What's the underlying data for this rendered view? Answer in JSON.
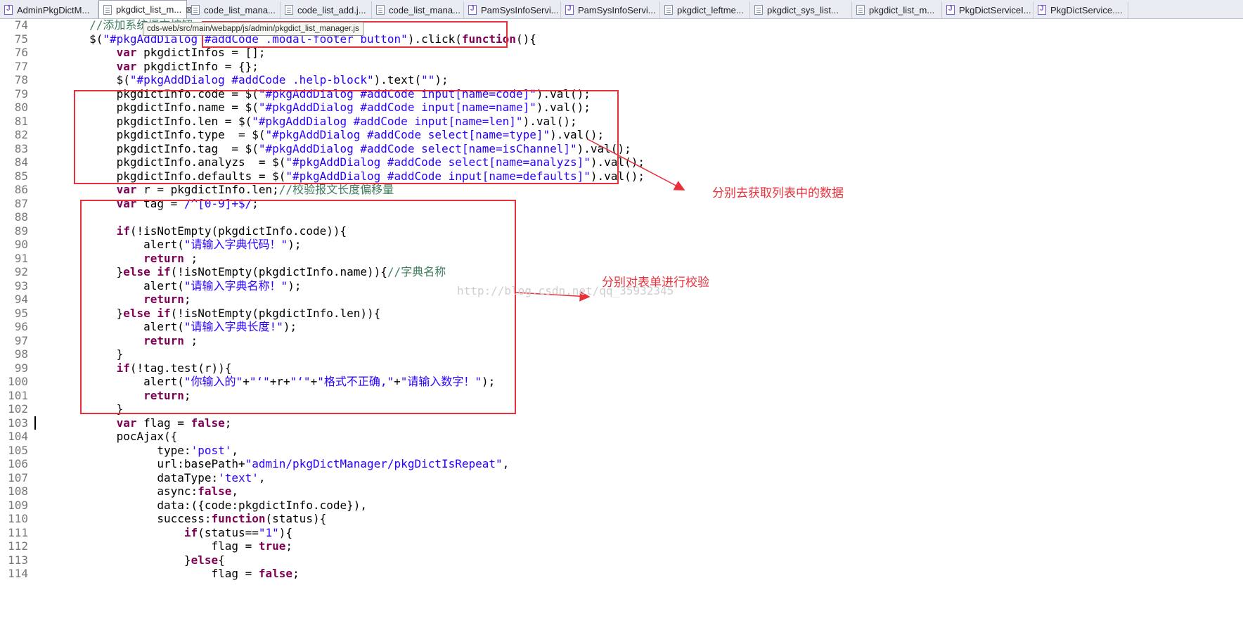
{
  "tabs": [
    {
      "label": "AdminPkgDictM...",
      "icon": "java-file-icon",
      "active": false
    },
    {
      "label": "pkgdict_list_m...",
      "icon": "js-file-icon",
      "active": true
    },
    {
      "label": "code_list_mana...",
      "icon": "js-file-icon",
      "active": false
    },
    {
      "label": "code_list_add.j...",
      "icon": "js-file-icon",
      "active": false
    },
    {
      "label": "code_list_mana...",
      "icon": "js-file-icon",
      "active": false
    },
    {
      "label": "PamSysInfoServi...",
      "icon": "java-file-icon",
      "active": false
    },
    {
      "label": "PamSysInfoServi...",
      "icon": "java-file-icon",
      "active": false
    },
    {
      "label": "pkgdict_leftme...",
      "icon": "js-file-icon",
      "active": false
    },
    {
      "label": "pkgdict_sys_list...",
      "icon": "js-file-icon",
      "active": false
    },
    {
      "label": "pkgdict_list_m...",
      "icon": "js-file-icon",
      "active": false
    },
    {
      "label": "PkgDictServiceI...",
      "icon": "java-file-icon",
      "active": false
    },
    {
      "label": "PkgDictService....",
      "icon": "java-file-icon",
      "active": false
    }
  ],
  "tab_close_glyph": "⊠",
  "tooltip": "cds-web/src/main/webapp/js/admin/pkgdict_list_manager.js",
  "lines": [
    {
      "n": "74",
      "segs": [
        [
          "",
          "        "
        ],
        [
          "cm",
          "//添加系统提交按钮"
        ]
      ]
    },
    {
      "n": "75",
      "segs": [
        [
          "",
          "        $("
        ],
        [
          "str",
          "\"#pkgAddDialog #addCode .modal-footer button\""
        ],
        [
          "",
          ").click("
        ],
        [
          "kw",
          "function"
        ],
        [
          "",
          "(){"
        ]
      ]
    },
    {
      "n": "76",
      "segs": [
        [
          "",
          "            "
        ],
        [
          "kw",
          "var"
        ],
        [
          "",
          " pkgdictInfos = [];"
        ]
      ]
    },
    {
      "n": "77",
      "segs": [
        [
          "",
          "            "
        ],
        [
          "kw",
          "var"
        ],
        [
          "",
          " pkgdictInfo = {};"
        ]
      ]
    },
    {
      "n": "78",
      "segs": [
        [
          "",
          "            $("
        ],
        [
          "str",
          "\"#pkgAddDialog #addCode .help-block\""
        ],
        [
          "",
          ").text("
        ],
        [
          "str",
          "\"\""
        ],
        [
          "",
          ");"
        ]
      ]
    },
    {
      "n": "79",
      "segs": [
        [
          "",
          "            pkgdictInfo.code = $("
        ],
        [
          "str",
          "\"#pkgAddDialog #addCode input[name=code]\""
        ],
        [
          "",
          ").val();"
        ]
      ]
    },
    {
      "n": "80",
      "segs": [
        [
          "",
          "            pkgdictInfo.name = $("
        ],
        [
          "str",
          "\"#pkgAddDialog #addCode input[name=name]\""
        ],
        [
          "",
          ").val();"
        ]
      ]
    },
    {
      "n": "81",
      "segs": [
        [
          "",
          "            pkgdictInfo.len = $("
        ],
        [
          "str",
          "\"#pkgAddDialog #addCode input[name=len]\""
        ],
        [
          "",
          ").val();"
        ]
      ]
    },
    {
      "n": "82",
      "segs": [
        [
          "",
          "            pkgdictInfo.type  = $("
        ],
        [
          "str",
          "\"#pkgAddDialog #addCode select[name=type]\""
        ],
        [
          "",
          ").val();"
        ]
      ]
    },
    {
      "n": "83",
      "segs": [
        [
          "",
          "            pkgdictInfo.tag  = $("
        ],
        [
          "str",
          "\"#pkgAddDialog #addCode select[name=isChannel]\""
        ],
        [
          "",
          ").val();"
        ]
      ]
    },
    {
      "n": "84",
      "segs": [
        [
          "",
          "            pkgdictInfo.analyzs  = $("
        ],
        [
          "str",
          "\"#pkgAddDialog #addCode select[name=analyzs]\""
        ],
        [
          "",
          ").val();"
        ]
      ]
    },
    {
      "n": "85",
      "segs": [
        [
          "",
          "            pkgdictInfo.defaults = $("
        ],
        [
          "str",
          "\"#pkgAddDialog #addCode input[name=defaults]\""
        ],
        [
          "",
          ").val();"
        ]
      ]
    },
    {
      "n": "86",
      "segs": [
        [
          "",
          "            "
        ],
        [
          "kw",
          "var"
        ],
        [
          "",
          " r = pkgdictInfo.len;"
        ],
        [
          "cm",
          "//校验报文长度偏移量"
        ]
      ]
    },
    {
      "n": "87",
      "segs": [
        [
          "",
          "            "
        ],
        [
          "kw",
          "var"
        ],
        [
          "",
          " tag = "
        ],
        [
          "str",
          "/^[0-9]+$/"
        ],
        [
          "",
          ";"
        ]
      ]
    },
    {
      "n": "88",
      "segs": [
        [
          "",
          ""
        ]
      ]
    },
    {
      "n": "89",
      "segs": [
        [
          "",
          "            "
        ],
        [
          "kw",
          "if"
        ],
        [
          "",
          "(!isNotEmpty(pkgdictInfo.code)){"
        ]
      ]
    },
    {
      "n": "90",
      "segs": [
        [
          "",
          "                alert("
        ],
        [
          "str",
          "\"请输入字典代码！\""
        ],
        [
          "",
          ");"
        ]
      ]
    },
    {
      "n": "91",
      "segs": [
        [
          "",
          "                "
        ],
        [
          "kw",
          "return"
        ],
        [
          "",
          " ;"
        ]
      ]
    },
    {
      "n": "92",
      "segs": [
        [
          "",
          "            }"
        ],
        [
          "kw",
          "else if"
        ],
        [
          "",
          "(!isNotEmpty(pkgdictInfo.name)){"
        ],
        [
          "cm",
          "//字典名称"
        ]
      ]
    },
    {
      "n": "93",
      "segs": [
        [
          "",
          "                alert("
        ],
        [
          "str",
          "\"请输入字典名称！\""
        ],
        [
          "",
          ");"
        ]
      ]
    },
    {
      "n": "94",
      "segs": [
        [
          "",
          "                "
        ],
        [
          "kw",
          "return"
        ],
        [
          "",
          ";"
        ]
      ]
    },
    {
      "n": "95",
      "segs": [
        [
          "",
          "            }"
        ],
        [
          "kw",
          "else if"
        ],
        [
          "",
          "(!isNotEmpty(pkgdictInfo.len)){"
        ]
      ]
    },
    {
      "n": "96",
      "segs": [
        [
          "",
          "                alert("
        ],
        [
          "str",
          "\"请输入字典长度!\""
        ],
        [
          "",
          ");"
        ]
      ]
    },
    {
      "n": "97",
      "segs": [
        [
          "",
          "                "
        ],
        [
          "kw",
          "return"
        ],
        [
          "",
          " ;"
        ]
      ]
    },
    {
      "n": "98",
      "segs": [
        [
          "",
          "            }"
        ]
      ]
    },
    {
      "n": "99",
      "segs": [
        [
          "",
          "            "
        ],
        [
          "kw",
          "if"
        ],
        [
          "",
          "(!tag.test(r)){"
        ]
      ]
    },
    {
      "n": "100",
      "segs": [
        [
          "",
          "                alert("
        ],
        [
          "str",
          "\"你输入的\""
        ],
        [
          "",
          "+"
        ],
        [
          "str",
          "\"‘\""
        ],
        [
          "",
          "+r+"
        ],
        [
          "str",
          "\"‘\""
        ],
        [
          "",
          "+"
        ],
        [
          "str",
          "\"格式不正确,\""
        ],
        [
          "",
          "+"
        ],
        [
          "str",
          "\"请输入数字！\""
        ],
        [
          "",
          ");"
        ]
      ]
    },
    {
      "n": "101",
      "segs": [
        [
          "",
          "                "
        ],
        [
          "kw",
          "return"
        ],
        [
          "",
          ";"
        ]
      ]
    },
    {
      "n": "102",
      "segs": [
        [
          "",
          "            }"
        ]
      ]
    },
    {
      "n": "103",
      "segs": [
        [
          "",
          "            "
        ],
        [
          "kw",
          "var"
        ],
        [
          "",
          " flag = "
        ],
        [
          "kw",
          "false"
        ],
        [
          "",
          ";"
        ]
      ]
    },
    {
      "n": "104",
      "segs": [
        [
          "",
          "            pocAjax({"
        ]
      ]
    },
    {
      "n": "105",
      "segs": [
        [
          "",
          "                  type:"
        ],
        [
          "str",
          "'post'"
        ],
        [
          "",
          ","
        ]
      ]
    },
    {
      "n": "106",
      "segs": [
        [
          "",
          "                  url:basePath+"
        ],
        [
          "str",
          "\"admin/pkgDictManager/pkgDictIsRepeat\""
        ],
        [
          "",
          ","
        ]
      ]
    },
    {
      "n": "107",
      "segs": [
        [
          "",
          "                  dataType:"
        ],
        [
          "str",
          "'text'"
        ],
        [
          "",
          ","
        ]
      ]
    },
    {
      "n": "108",
      "segs": [
        [
          "",
          "                  async:"
        ],
        [
          "kw",
          "false"
        ],
        [
          "",
          ","
        ]
      ]
    },
    {
      "n": "109",
      "segs": [
        [
          "",
          "                  data:({code:pkgdictInfo.code}),"
        ]
      ]
    },
    {
      "n": "110",
      "segs": [
        [
          "",
          "                  success:"
        ],
        [
          "kw",
          "function"
        ],
        [
          "",
          "(status){"
        ]
      ]
    },
    {
      "n": "111",
      "segs": [
        [
          "",
          "                      "
        ],
        [
          "kw",
          "if"
        ],
        [
          "",
          "(status=="
        ],
        [
          "str",
          "\"1\""
        ],
        [
          "",
          "){"
        ]
      ]
    },
    {
      "n": "112",
      "segs": [
        [
          "",
          "                          flag = "
        ],
        [
          "kw",
          "true"
        ],
        [
          "",
          ";"
        ]
      ]
    },
    {
      "n": "113",
      "segs": [
        [
          "",
          "                      }"
        ],
        [
          "kw",
          "else"
        ],
        [
          "",
          "{"
        ]
      ]
    },
    {
      "n": "114",
      "segs": [
        [
          "",
          "                          flag = "
        ],
        [
          "kw",
          "false"
        ],
        [
          "",
          ";"
        ]
      ]
    }
  ],
  "annotations": {
    "fetch_note": "分别去获取列表中的数据",
    "validate_note": "分别对表单进行校验"
  },
  "watermark": "http://blog.csdn.net/qq_35932345",
  "colors": {
    "annotation_red": "#e8303a",
    "keyword": "#7f0055",
    "string": "#2a00ff",
    "comment": "#3f7f5f"
  }
}
